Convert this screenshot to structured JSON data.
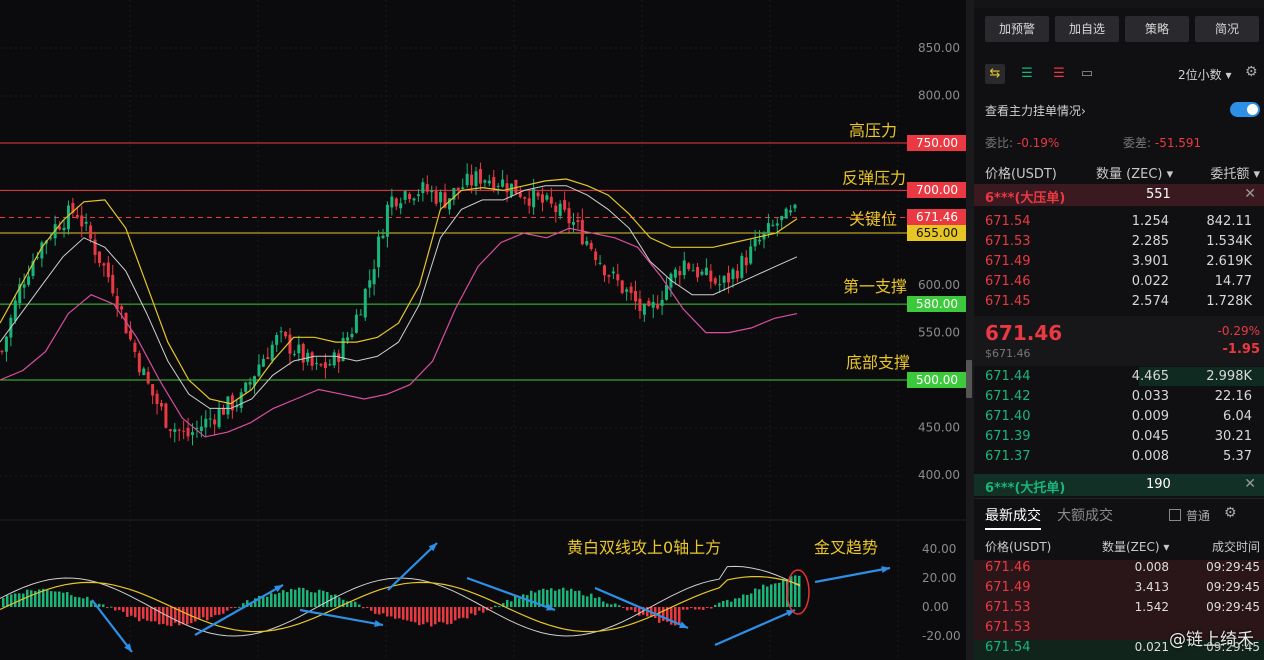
{
  "colors": {
    "up": "#1ab57a",
    "down": "#ea3943",
    "ma_yellow": "#e6c525",
    "ma_white": "#cfcfcf",
    "boll_lower": "#d94ea0",
    "annotation": "#e9c62b",
    "arrow": "#2d8fe6"
  },
  "price_axis": {
    "labels": [
      "850.00",
      "800.00",
      "600.00",
      "550.00",
      "450.00",
      "400.00"
    ]
  },
  "macd_axis": {
    "labels": [
      "40.00",
      "20.00",
      "0.00",
      "-20.00"
    ]
  },
  "levels": [
    {
      "label": "高压力",
      "value": "750.00",
      "color": "#ea3943",
      "text_color": "#ffffff"
    },
    {
      "label": "反弹压力",
      "value": "700.00",
      "color": "#ea3943",
      "text_color": "#ffffff"
    },
    {
      "label": "关键位",
      "value": "671.46",
      "color": "#ea3943",
      "text_color": "#ffffff"
    },
    {
      "label": "",
      "value": "655.00",
      "color": "#e6c525",
      "text_color": "#111111"
    },
    {
      "label": "第一支撑",
      "value": "580.00",
      "color": "#3cc93c",
      "text_color": "#ffffff"
    },
    {
      "label": "底部支撑",
      "value": "500.00",
      "color": "#3cc93c",
      "text_color": "#ffffff"
    }
  ],
  "macd_annotations": {
    "main": "黄白双线攻上0轴上方",
    "cross": "金叉趋势"
  },
  "panel": {
    "buttons": [
      "加预警",
      "加自选",
      "策略",
      "简况"
    ],
    "decimals": "2位小数",
    "view_orders": "查看主力挂单情况",
    "wei_bi_label": "委比:",
    "wei_bi": "-0.19%",
    "wei_cha_label": "委差:",
    "wei_cha": "-51.591",
    "col_price": "价格(USDT)",
    "col_qty": "数量 (ZEC)",
    "col_total": "委托额",
    "big_ask": {
      "label": "6***(大压单)",
      "qty": "551"
    },
    "asks": [
      {
        "price": "671.54",
        "qty": "1.254",
        "total": "842.11"
      },
      {
        "price": "671.53",
        "qty": "2.285",
        "total": "1.534K"
      },
      {
        "price": "671.49",
        "qty": "3.901",
        "total": "2.619K"
      },
      {
        "price": "671.46",
        "qty": "0.022",
        "total": "14.77"
      },
      {
        "price": "671.45",
        "qty": "2.574",
        "total": "1.728K"
      }
    ],
    "last_price": "671.46",
    "last_price_usd": "$671.46",
    "change_pct": "-0.29%",
    "change_abs": "-1.95",
    "bids": [
      {
        "price": "671.44",
        "qty": "4.465",
        "total": "2.998K"
      },
      {
        "price": "671.42",
        "qty": "0.033",
        "total": "22.16"
      },
      {
        "price": "671.40",
        "qty": "0.009",
        "total": "6.04"
      },
      {
        "price": "671.39",
        "qty": "0.045",
        "total": "30.21"
      },
      {
        "price": "671.37",
        "qty": "0.008",
        "total": "5.37"
      }
    ],
    "big_bid": {
      "label": "6***(大托单)",
      "qty": "190"
    },
    "trades_tab": "最新成交",
    "big_trades_tab": "大额成交",
    "normal_label": "普通",
    "trade_col_price": "价格(USDT)",
    "trade_col_qty": "数量(ZEC)",
    "trade_col_time": "成交时间",
    "trades": [
      {
        "price": "671.46",
        "qty": "0.008",
        "time": "09:29:45",
        "side": "sell"
      },
      {
        "price": "671.49",
        "qty": "3.413",
        "time": "09:29:45",
        "side": "sell"
      },
      {
        "price": "671.53",
        "qty": "1.542",
        "time": "09:29:45",
        "side": "sell"
      },
      {
        "price": "671.53",
        "qty": "",
        "time": "",
        "side": "sell"
      },
      {
        "price": "671.54",
        "qty": "0.021",
        "time": "09:29:45",
        "side": "buy"
      }
    ],
    "watermark": "@链上绮禾"
  },
  "chart_data": {
    "type": "candlestick",
    "y_unit": "USDT",
    "ylim": [
      375,
      875
    ],
    "horizontal_levels": [
      750,
      700,
      671.46,
      655,
      580,
      500
    ],
    "close_path": [
      530,
      600,
      640,
      665,
      680,
      640,
      600,
      540,
      490,
      455,
      440,
      455,
      470,
      480,
      520,
      545,
      530,
      510,
      520,
      555,
      610,
      690,
      700,
      700,
      690,
      705,
      715,
      710,
      700,
      690,
      680,
      665,
      640,
      610,
      590,
      565,
      600,
      625,
      610,
      600,
      620,
      645,
      665,
      675
    ],
    "ma_yellow": [
      560,
      600,
      640,
      668,
      688,
      690,
      660,
      600,
      540,
      500,
      480,
      475,
      490,
      520,
      545,
      545,
      540,
      540,
      545,
      560,
      600,
      680,
      700,
      703,
      700,
      705,
      710,
      712,
      705,
      695,
      675,
      650,
      640,
      640,
      640,
      645,
      650,
      655,
      670
    ],
    "ma_white": [
      540,
      570,
      600,
      630,
      650,
      640,
      615,
      570,
      520,
      485,
      470,
      470,
      480,
      505,
      520,
      525,
      525,
      520,
      525,
      540,
      580,
      650,
      680,
      690,
      690,
      700,
      705,
      705,
      695,
      680,
      660,
      625,
      605,
      590,
      590,
      600,
      610,
      620,
      630
    ],
    "boll_lower": [
      500,
      510,
      530,
      570,
      590,
      580,
      545,
      500,
      460,
      440,
      445,
      455,
      470,
      480,
      490,
      485,
      480,
      485,
      495,
      520,
      575,
      620,
      645,
      655,
      650,
      660,
      655,
      650,
      640,
      610,
      575,
      550,
      550,
      555,
      565,
      570
    ],
    "macd_hist_direction": "negative then positive, golden cross at end"
  }
}
